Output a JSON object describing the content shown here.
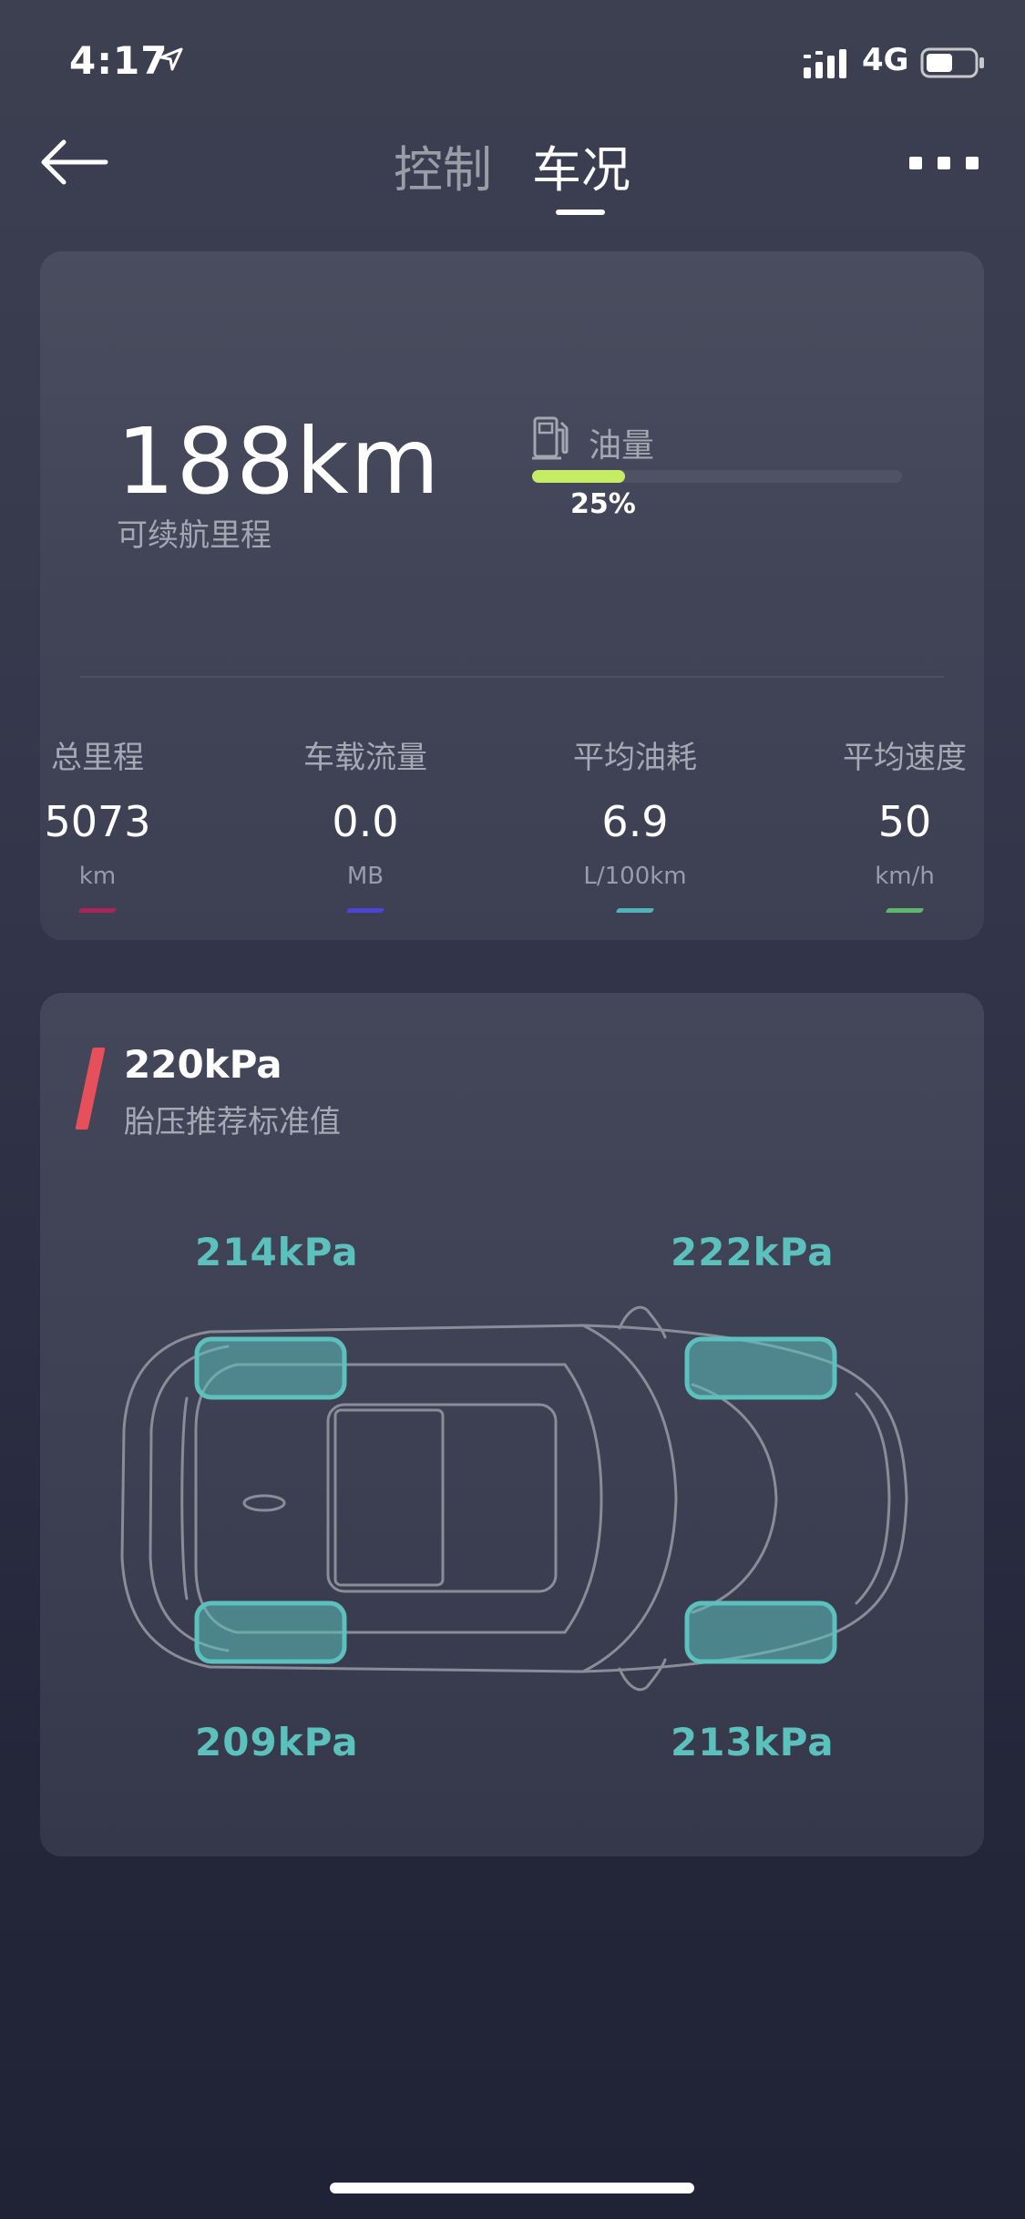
{
  "status_bar": {
    "time": "4:17",
    "network": "4G"
  },
  "nav": {
    "tab_control": "控制",
    "tab_condition": "车况",
    "active_tab": "车况"
  },
  "overview": {
    "range_value": "188km",
    "range_label": "可续航里程",
    "fuel_label": "油量",
    "fuel_percent_text": "25%",
    "fuel_level": 0.25,
    "fuel_color": "#c6ec66"
  },
  "stats": [
    {
      "label": "总里程",
      "value": "5073",
      "unit": "km",
      "color": "#a8265a"
    },
    {
      "label": "车载流量",
      "value": "0.0",
      "unit": "MB",
      "color": "#4a45d8"
    },
    {
      "label": "平均油耗",
      "value": "6.9",
      "unit": "L/100km",
      "color": "#4fb3b8"
    },
    {
      "label": "平均速度",
      "value": "50",
      "unit": "km/h",
      "color": "#5cb86a"
    }
  ],
  "tire": {
    "recommended_value": "220kPa",
    "recommended_label": "胎压推荐标准值",
    "front_left": "214kPa",
    "front_right": "222kPa",
    "rear_left": "209kPa",
    "rear_right": "213kPa",
    "tire_color": "#5cc0bd"
  }
}
